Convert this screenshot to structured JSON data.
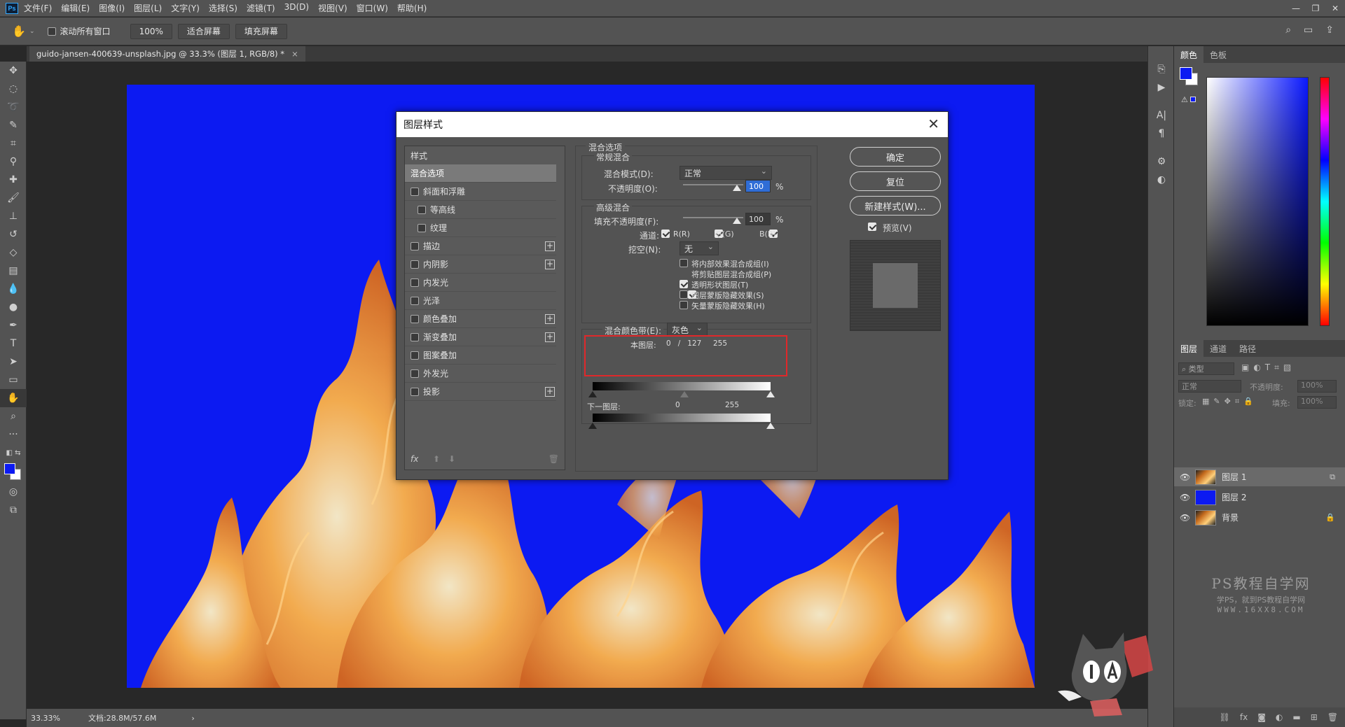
{
  "app": {
    "logo": "Ps",
    "menu": [
      "文件(F)",
      "编辑(E)",
      "图像(I)",
      "图层(L)",
      "文字(Y)",
      "选择(S)",
      "滤镜(T)",
      "3D(D)",
      "视图(V)",
      "窗口(W)",
      "帮助(H)"
    ]
  },
  "options": {
    "scroll_all_label": "滚动所有窗口",
    "zoom_value": "100%",
    "fit_screen_label": "适合屏幕",
    "fill_screen_label": "填充屏幕"
  },
  "document": {
    "tab_title": "guido-jansen-400639-unsplash.jpg @ 33.3% (图层 1, RGB/8) *",
    "tab_close": "×"
  },
  "status": {
    "zoom": "33.33%",
    "doc_size": "文档:28.8M/57.6M",
    "arrow": "›"
  },
  "dialog": {
    "title": "图层样式",
    "close": "✕",
    "styles_header": "样式",
    "style_items": [
      {
        "label": "混合选项",
        "selected": true,
        "checkbox": false,
        "plus": false,
        "indent": false
      },
      {
        "label": "斜面和浮雕",
        "checkbox": true,
        "plus": false,
        "indent": false
      },
      {
        "label": "等高线",
        "checkbox": true,
        "plus": false,
        "indent": true
      },
      {
        "label": "纹理",
        "checkbox": true,
        "plus": false,
        "indent": true
      },
      {
        "label": "描边",
        "checkbox": true,
        "plus": true,
        "indent": false
      },
      {
        "label": "内阴影",
        "checkbox": true,
        "plus": true,
        "indent": false
      },
      {
        "label": "内发光",
        "checkbox": true,
        "plus": false,
        "indent": false
      },
      {
        "label": "光泽",
        "checkbox": true,
        "plus": false,
        "indent": false
      },
      {
        "label": "颜色叠加",
        "checkbox": true,
        "plus": true,
        "indent": false
      },
      {
        "label": "渐变叠加",
        "checkbox": true,
        "plus": true,
        "indent": false
      },
      {
        "label": "图案叠加",
        "checkbox": true,
        "plus": false,
        "indent": false
      },
      {
        "label": "外发光",
        "checkbox": true,
        "plus": false,
        "indent": false
      },
      {
        "label": "投影",
        "checkbox": true,
        "plus": true,
        "indent": false
      }
    ],
    "fx_label": "fx",
    "blend_options_title": "混合选项",
    "general_blending": "常规混合",
    "blend_mode_label": "混合模式(D):",
    "blend_mode_value": "正常",
    "opacity_label": "不透明度(O):",
    "opacity_value": "100",
    "percent": "%",
    "advanced_blending": "高级混合",
    "fill_opacity_label": "填充不透明度(F):",
    "fill_opacity_value": "100",
    "channels_label": "通道:",
    "channel_r": "R(R)",
    "channel_g": "G(G)",
    "channel_b": "B(B)",
    "knockout_label": "挖空(N):",
    "knockout_value": "无",
    "adv_options": [
      {
        "label": "将内部效果混合成组(I)",
        "checked": false
      },
      {
        "label": "将剪贴图层混合成组(P)",
        "checked": true
      },
      {
        "label": "透明形状图层(T)",
        "checked": true
      },
      {
        "label": "图层蒙版隐藏效果(S)",
        "checked": false
      },
      {
        "label": "矢量蒙版隐藏效果(H)",
        "checked": false
      }
    ],
    "blend_if_label": "混合颜色带(E):",
    "blend_if_value": "灰色",
    "this_layer_label": "本图层:",
    "this_layer_values": "0   /   127     255",
    "underlying_label": "下一图层:",
    "underlying_min": "0",
    "underlying_max": "255",
    "ok": "确定",
    "reset": "复位",
    "new_style": "新建样式(W)...",
    "preview_label": "预览(V)"
  },
  "panels": {
    "color_tabs": [
      "颜色",
      "色板"
    ],
    "layer_tabs": [
      "图层",
      "通道",
      "路径"
    ],
    "kind_label": "类型",
    "blend_mode": "正常",
    "opacity_label": "不透明度:",
    "opacity_value": "100%",
    "lock_label": "锁定:",
    "fill_label": "填充:",
    "fill_value": "100%",
    "layers": [
      {
        "name": "图层 1",
        "selected": true,
        "thumb": "fire"
      },
      {
        "name": "图层 2",
        "selected": false,
        "thumb": "blue"
      },
      {
        "name": "背景",
        "selected": false,
        "thumb": "fire",
        "locked": true
      }
    ]
  },
  "watermark": {
    "title": "PS教程自学网",
    "subtitle": "学PS，就到PS教程自学网",
    "url": "WWW.16XX8.COM"
  },
  "colors": {
    "fg": "#0c1af2",
    "canvas_blue": "#0c1af2",
    "highlight": "#e0282a"
  }
}
